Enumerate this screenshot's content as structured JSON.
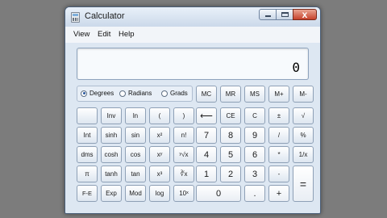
{
  "window": {
    "title": "Calculator",
    "close_glyph": "x"
  },
  "menu": [
    "View",
    "Edit",
    "Help"
  ],
  "display": {
    "value": "0"
  },
  "angle_modes": [
    {
      "label": "Degrees",
      "selected": true
    },
    {
      "label": "Radians",
      "selected": false
    },
    {
      "label": "Grads",
      "selected": false
    }
  ],
  "memory_keys": [
    "MC",
    "MR",
    "MS",
    "M+",
    "M-"
  ],
  "keys": {
    "r2": [
      "",
      "Inv",
      "ln",
      "(",
      ")",
      "⟵",
      "CE",
      "C",
      "±",
      "√"
    ],
    "r3": [
      "Int",
      "sinh",
      "sin",
      "x²",
      "n!",
      "7",
      "8",
      "9",
      "/",
      "%"
    ],
    "r4": [
      "dms",
      "cosh",
      "cos",
      "xʸ",
      "ʸ√x",
      "4",
      "5",
      "6",
      "*",
      "1/x"
    ],
    "r5": [
      "π",
      "tanh",
      "tan",
      "x³",
      "∛x",
      "1",
      "2",
      "3",
      "-"
    ],
    "r6": [
      "F-E",
      "Exp",
      "Mod",
      "log",
      "10ˣ",
      "0",
      ".",
      "+"
    ],
    "equals": "="
  },
  "colors": {
    "background": "#7c7c7c",
    "window": "#dde7f2",
    "display": "#f7fafd"
  }
}
